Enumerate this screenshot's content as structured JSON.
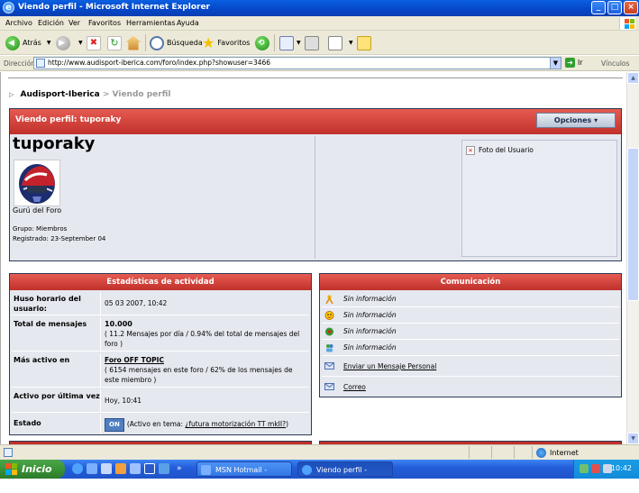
{
  "window": {
    "title": "Viendo perfil - Microsoft Internet Explorer",
    "controls": [
      "_",
      "□",
      "×"
    ]
  },
  "menu": [
    "Archivo",
    "Edición",
    "Ver",
    "Favoritos",
    "Herramientas",
    "Ayuda"
  ],
  "toolbar": {
    "back_label": "Atrás",
    "search_label": "Búsqueda",
    "favorites_label": "Favoritos"
  },
  "address": {
    "label": "Dirección",
    "url": "http://www.audisport-iberica.com/foro/index.php?showuser=3466",
    "go_label": "Ir",
    "links_label": "Vínculos"
  },
  "breadcrumb": {
    "site": "Audisport-Iberica",
    "separator": ">",
    "current": "Viendo perfil"
  },
  "profile": {
    "header": "Viendo perfil: tuporaky",
    "options_label": "Opciones",
    "username": "tuporaky",
    "rank": "Gurú del Foro",
    "group": "Grupo: Miembros",
    "registered": "Registrado: 23-September 04",
    "photo_label": "Foto del Usuario"
  },
  "stats": {
    "header": "Estadísticas de actividad",
    "rows": [
      {
        "key": "Huso horario del usuario:",
        "value": "05 03 2007, 10:42"
      },
      {
        "key": "Total de mensajes",
        "value": "10.000",
        "detail": "( 11.2 Mensajes por día / 0.94% del total de mensajes del foro )"
      },
      {
        "key": "Más activo en",
        "value": "Foro OFF TOPIC",
        "detail": "( 6154 mensajes en este foro / 62% de los mensajes de este miembro )"
      },
      {
        "key": "Activo por última vez",
        "value": "Hoy, 10:41"
      },
      {
        "key": "Estado",
        "badge": "ON",
        "prefix": "(Activo en tema: ",
        "link": "¿futura motorización TT mkII?",
        "suffix": ")"
      }
    ]
  },
  "communication": {
    "header": "Comunicación",
    "rows": [
      {
        "icon": "aim-icon",
        "text": "Sin información"
      },
      {
        "icon": "yahoo-icon",
        "text": "Sin información"
      },
      {
        "icon": "icq-icon",
        "text": "Sin información"
      },
      {
        "icon": "msn-icon",
        "text": "Sin información"
      },
      {
        "icon": "mail-icon",
        "text": "Enviar un Mensaje Personal"
      },
      {
        "icon": "mail-icon",
        "text": "Correo"
      }
    ]
  },
  "statusbar": {
    "zone": "Internet"
  },
  "taskbar": {
    "start_label": "Inicio",
    "tasks": [
      {
        "label": "MSN Hotmail - Nuevo ...",
        "active": false
      },
      {
        "label": "Viendo perfil - Micros...",
        "active": true
      }
    ],
    "clock": "10:42"
  },
  "colors": {
    "header_red": "#c0302a",
    "panel_bg": "#e5e8ef",
    "border_navy": "#2a3b55",
    "xp_blue": "#245edb",
    "start_green": "#3a9237"
  }
}
